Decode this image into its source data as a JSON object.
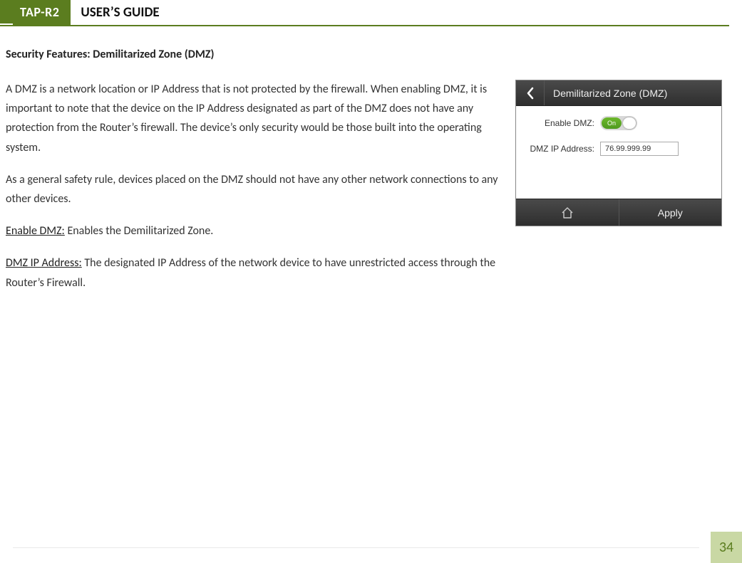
{
  "header": {
    "product": "TAP-R2",
    "title": "USER’S GUIDE"
  },
  "section_title": "Security Features: Demilitarized Zone (DMZ)",
  "paragraphs": {
    "p1": "A DMZ is a network location or IP Address that is not protected by the firewall.  When enabling DMZ, it is important to note that the device on the IP Address designated as part of the DMZ does not have any protection from the Router’s firewall.  The device’s only security would be those built into the operating system.",
    "p2": "As a general safety rule, devices placed on the DMZ should not have any other network connections to any other devices.",
    "p3_label": "Enable DMZ:",
    "p3_text": " Enables the Demilitarized Zone.",
    "p4_label": "DMZ IP Address:",
    "p4_text": " The designated IP Address of the network device to have unrestricted access through the Router’s Firewall."
  },
  "screenshot": {
    "title": "Demilitarized Zone (DMZ)",
    "enable_label": "Enable DMZ:",
    "toggle_state": "On",
    "ip_label": "DMZ IP Address:",
    "ip_value": "76.99.999.99",
    "apply": "Apply"
  },
  "page_number": "34"
}
